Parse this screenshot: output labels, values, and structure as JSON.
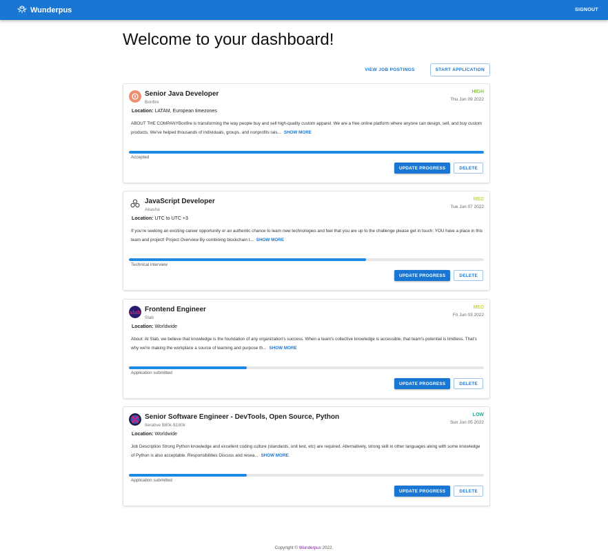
{
  "appbar": {
    "brand": "Wunderpus",
    "signout": "SIGNOUT"
  },
  "page": {
    "title": "Welcome to your dashboard!"
  },
  "actions": {
    "view_jobs": "VIEW JOB POSTINGS",
    "start_application": "START APPLICATION"
  },
  "labels": {
    "location": "Location:",
    "show_more": "SHOW MORE",
    "update_progress": "UPDATE PROGRESS",
    "delete": "DELETE"
  },
  "cards": [
    {
      "title": "Senior Java Developer",
      "company": "Bonfire",
      "priority": "HIGH",
      "priority_color": "#8bc34a",
      "date": "Thu Jun 09 2022",
      "location": "LATAM, European timezones",
      "description": "ABOUT THE COMPANYBonfire is transforming the way people buy and sell high-quality custom apparel. We are a free online platform where anyone can design, sell, and buy custom products. We've helped thousands of individuals, groups, and nonprofits rais...",
      "progress": 1.0,
      "status": "Accepted",
      "logo_icon": "bonfire-logo-icon"
    },
    {
      "title": "JavaScript Developer",
      "company": "Akasha",
      "priority": "MED",
      "priority_color": "#cddc39",
      "date": "Tue Jun 07 2022",
      "location": "UTC to UTC +3",
      "description": "If you're seeking an exciting career opportunity or an authentic chance to learn new technologies and feel that you are up to the challenge please get in touch:  YOU  have a place in this team and project!   Project Overview By combining blockchain t...",
      "progress": 0.667,
      "status": "Technical interview",
      "logo_icon": "akasha-logo-icon"
    },
    {
      "title": "Frontend Engineer",
      "company": "Slab",
      "priority": "MED",
      "priority_color": "#cddc39",
      "date": "Fri Jun 03 2022",
      "location": "Worldwide",
      "description": "About: At Slab, we believe that knowledge is the foundation of any organization's success. When a team's collective knowledge is accessible, that team's potential is limitless. That's why we're making the workplace a source of learning and purpose th...",
      "progress": 0.333,
      "status": "Application submitted",
      "logo_icon": "slab-logo-icon"
    },
    {
      "title": "Senior Software Engineer - DevTools, Open Source, Python",
      "company": "Iterative $80k-$180k",
      "priority": "LOW",
      "priority_color": "#26a69a",
      "date": "Sun Jun 05 2022",
      "location": "Worldwide",
      "description": "Job Description Strong Python knowledge and excellent coding culture (standards, unit test, etc) are required. Alternatively, strong skill in other languages along with some knowledge of Python is also acceptable. Responsibilities Discuss and resea...",
      "progress": 0.333,
      "status": "Application submitted",
      "logo_icon": "iterative-logo-icon"
    }
  ],
  "footer": {
    "prefix": "Copyright © ",
    "brand": "Wunderpus",
    "suffix": " 2022."
  },
  "colors": {
    "primary": "#1976d2",
    "footer_brand": "#7b1fa2"
  }
}
